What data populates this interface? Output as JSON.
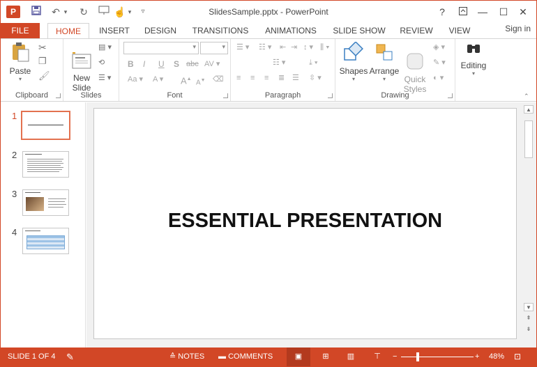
{
  "app": {
    "logo_letter": "P",
    "title": "SlidesSample.pptx - PowerPoint"
  },
  "window": {
    "help": "?",
    "restore_ribbon": "⤒",
    "minimize": "—",
    "maximize": "☐",
    "close": "✕"
  },
  "tabs": [
    {
      "label": "FILE"
    },
    {
      "label": "HOME"
    },
    {
      "label": "INSERT"
    },
    {
      "label": "DESIGN"
    },
    {
      "label": "TRANSITIONS"
    },
    {
      "label": "ANIMATIONS"
    },
    {
      "label": "SLIDE SHOW"
    },
    {
      "label": "REVIEW"
    },
    {
      "label": "VIEW"
    }
  ],
  "signin": "Sign in",
  "ribbon": {
    "clipboard": {
      "label": "Clipboard",
      "paste": "Paste"
    },
    "slides": {
      "label": "Slides",
      "new_slide": "New\nSlide"
    },
    "font": {
      "label": "Font"
    },
    "paragraph": {
      "label": "Paragraph"
    },
    "drawing": {
      "label": "Drawing",
      "shapes": "Shapes",
      "arrange": "Arrange",
      "quick_styles": "Quick\nStyles"
    },
    "editing": {
      "label": "Editing"
    }
  },
  "thumbnails": [
    {
      "num": "1",
      "active": true
    },
    {
      "num": "2",
      "active": false
    },
    {
      "num": "3",
      "active": false
    },
    {
      "num": "4",
      "active": false
    }
  ],
  "slide": {
    "title": "ESSENTIAL PRESENTATION"
  },
  "statusbar": {
    "slide_info": "SLIDE 1 OF 4",
    "notes": "NOTES",
    "comments": "COMMENTS",
    "zoom": "48%"
  },
  "colors": {
    "accent": "#d24726"
  }
}
